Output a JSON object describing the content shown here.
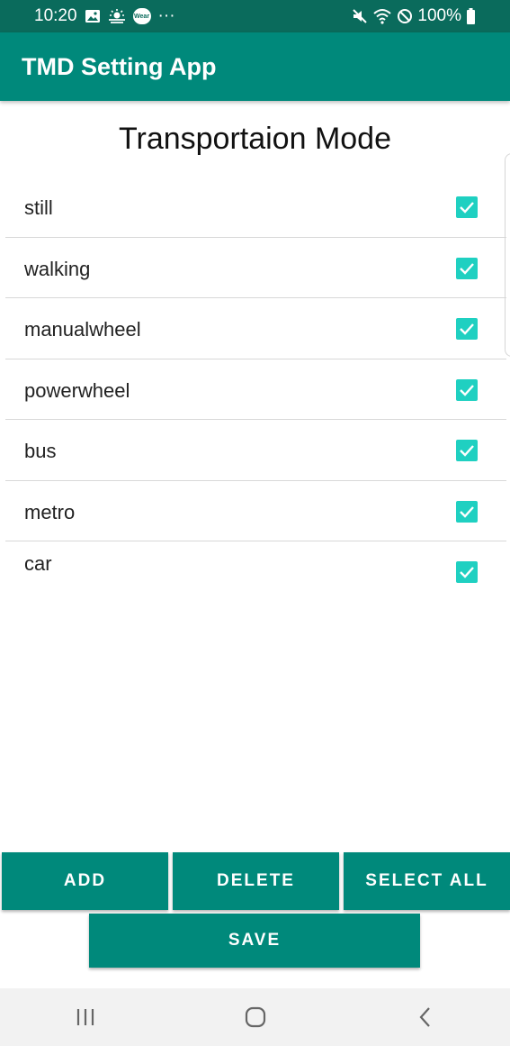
{
  "status_bar": {
    "time": "10:20",
    "more": "···",
    "battery": "100%",
    "wear_label": "Wear",
    "icons": [
      "image-icon",
      "weather-icon",
      "wear-icon",
      "mute-icon",
      "wifi-icon",
      "do-not-disturb-icon",
      "battery-icon"
    ]
  },
  "app_bar": {
    "title": "TMD Setting App"
  },
  "page": {
    "title": "Transportaion Mode"
  },
  "modes": [
    {
      "label": "still",
      "checked": true
    },
    {
      "label": "walking",
      "checked": true
    },
    {
      "label": "manualwheel",
      "checked": true
    },
    {
      "label": "powerwheel",
      "checked": true
    },
    {
      "label": "bus",
      "checked": true
    },
    {
      "label": "metro",
      "checked": true
    },
    {
      "label": "car",
      "checked": true
    }
  ],
  "buttons": {
    "add": "ADD",
    "delete": "DELETE",
    "select_all": "SELECT ALL",
    "save": "SAVE"
  },
  "nav": {
    "icons": [
      "recent-apps-icon",
      "home-icon",
      "back-icon"
    ]
  },
  "colors": {
    "status_bar": "#0a6b5c",
    "primary": "#00897b",
    "checkbox": "#1fd0c1",
    "nav_bar": "#f2f2f2"
  }
}
